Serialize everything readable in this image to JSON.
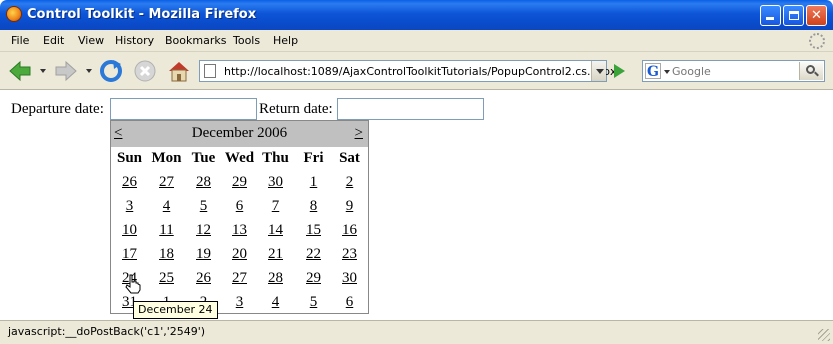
{
  "window": {
    "title": "Control Toolkit - Mozilla Firefox"
  },
  "menu": {
    "items": [
      {
        "label": "File"
      },
      {
        "label": "Edit"
      },
      {
        "label": "View"
      },
      {
        "label": "History"
      },
      {
        "label": "Bookmarks"
      },
      {
        "label": "Tools"
      },
      {
        "label": "Help"
      }
    ]
  },
  "toolbar": {
    "url": "http://localhost:1089/AjaxControlToolkitTutorials/PopupControl2.cs.aspx",
    "search_placeholder": "Google",
    "search_engine_letter": "G"
  },
  "form": {
    "departure_label": "Departure date:",
    "return_label": "Return date:",
    "departure_value": "",
    "return_value": ""
  },
  "calendar": {
    "prev": "<",
    "next": ">",
    "month_title": "December 2006",
    "weekdays": [
      "Sun",
      "Mon",
      "Tue",
      "Wed",
      "Thu",
      "Fri",
      "Sat"
    ],
    "weeks": [
      [
        "26",
        "27",
        "28",
        "29",
        "30",
        "1",
        "2"
      ],
      [
        "3",
        "4",
        "5",
        "6",
        "7",
        "8",
        "9"
      ],
      [
        "10",
        "11",
        "12",
        "13",
        "14",
        "15",
        "16"
      ],
      [
        "17",
        "18",
        "19",
        "20",
        "21",
        "22",
        "23"
      ],
      [
        "24",
        "25",
        "26",
        "27",
        "28",
        "29",
        "30"
      ],
      [
        "31",
        "1",
        "2",
        "3",
        "4",
        "5",
        "6"
      ]
    ]
  },
  "tooltip": {
    "text": "December 24"
  },
  "status": {
    "text": "javascript:__doPostBack('c1','2549')"
  }
}
